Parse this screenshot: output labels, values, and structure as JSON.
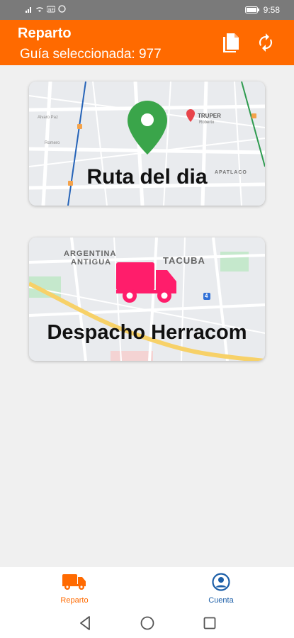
{
  "status_bar": {
    "time": "9:58",
    "battery_icon": "battery-icon",
    "left_icons": [
      "signal-icon",
      "wifi-icon",
      "nfc-icon",
      "whatsapp-icon"
    ]
  },
  "header": {
    "title": "Reparto",
    "subtitle": "Guía seleccionada: 977",
    "doc_icon": "document-icon",
    "sync_icon": "sync-icon"
  },
  "cards": [
    {
      "label": "Ruta del dia",
      "icon": "location-pin-icon",
      "map_labels": [
        "TRUPER",
        "Roberto",
        "Alvaro Paz",
        "Romero",
        "APATLACO"
      ]
    },
    {
      "label": "Despacho Herracom",
      "icon": "truck-icon",
      "map_labels": [
        "ARGENTINA",
        "ANTIGUA",
        "TACUBA",
        "4"
      ]
    }
  ],
  "bottom_nav": [
    {
      "label": "Reparto",
      "icon": "truck-icon",
      "active": true
    },
    {
      "label": "Cuenta",
      "icon": "account-icon",
      "active": false
    }
  ],
  "colors": {
    "brand_orange": "#ff6a00",
    "pin_green": "#3aa54a",
    "truck_pink": "#ff1d6b",
    "cuenta_blue": "#1d5fa8"
  }
}
